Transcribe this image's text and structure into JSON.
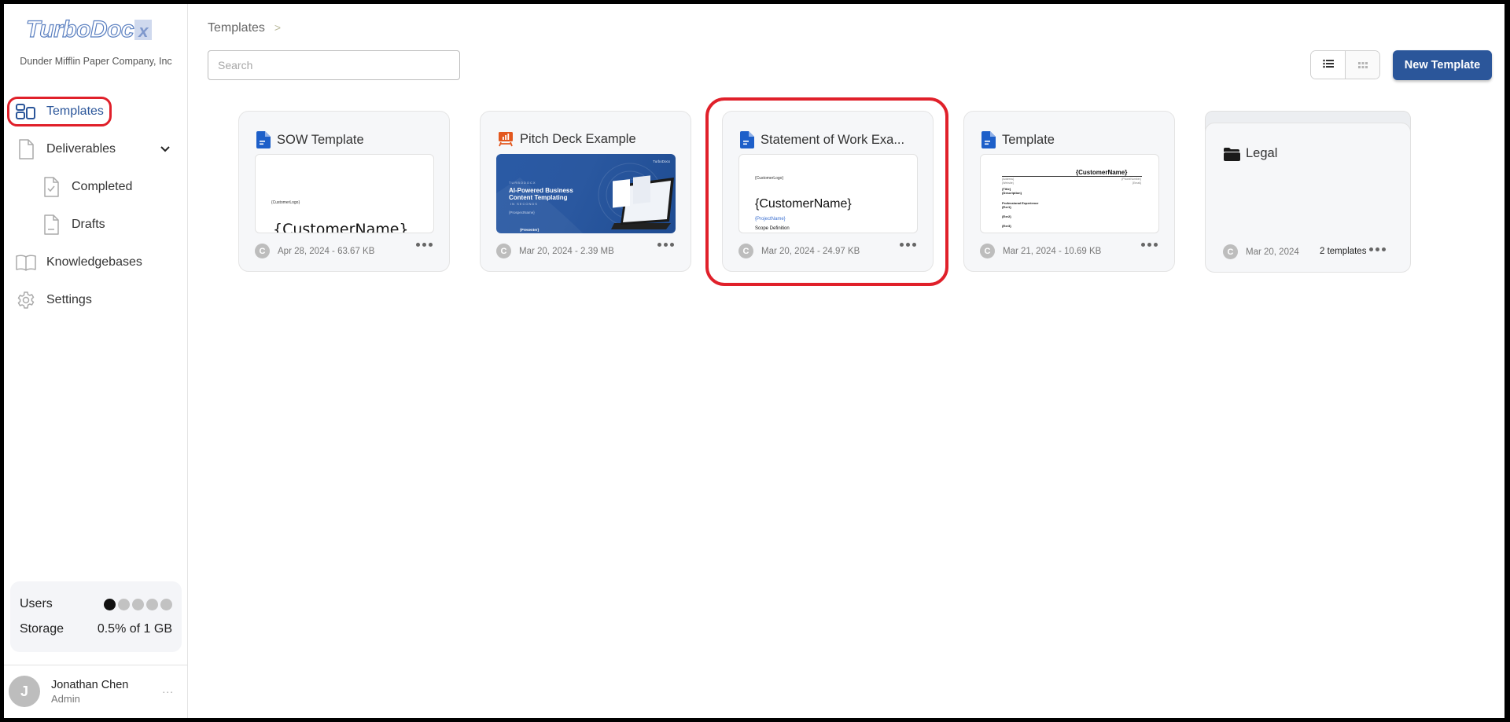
{
  "app": {
    "brand": "TurboDoc",
    "brand_suffix": "x",
    "organization": "Dunder Mifflin Paper Company, Inc"
  },
  "sidebar": {
    "items": [
      {
        "label": "Templates",
        "icon": "templates-grid-icon",
        "active": true
      },
      {
        "label": "Deliverables",
        "icon": "document-icon",
        "expanded": true
      },
      {
        "label": "Completed",
        "icon": "document-check-icon",
        "sub": true
      },
      {
        "label": "Drafts",
        "icon": "document-lines-icon",
        "sub": true
      },
      {
        "label": "Knowledgebases",
        "icon": "book-icon"
      },
      {
        "label": "Settings",
        "icon": "gear-icon"
      }
    ],
    "stats": {
      "users_label": "Users",
      "users_used": 1,
      "users_total": 5,
      "storage_label": "Storage",
      "storage_value": "0.5% of 1 GB"
    },
    "user": {
      "initial": "J",
      "name": "Jonathan Chen",
      "role": "Admin",
      "more": "..."
    }
  },
  "header": {
    "breadcrumb": "Templates",
    "breadcrumb_sep": ">",
    "search_placeholder": "Search",
    "search_value": "",
    "view_modes": [
      "list",
      "grid"
    ],
    "active_view": "list",
    "new_button": "New Template"
  },
  "colors": {
    "accent": "#2b569a",
    "highlight": "#e0202a",
    "doc_icon": "#1d5fc9",
    "slides_icon": "#e3581f"
  },
  "templates": [
    {
      "name": "SOW Template",
      "type": "document",
      "owner_initial": "C",
      "meta": "Apr 28, 2024 - 63.67 KB",
      "preview": {
        "logo": "{CustomerLogo}",
        "heading": "{CustomerName}"
      }
    },
    {
      "name": "Pitch Deck Example",
      "type": "presentation",
      "owner_initial": "C",
      "meta": "Mar 20, 2024 - 2.39 MB",
      "preview": {
        "brand_small": "TurboDocx",
        "kicker": "TURBODOCX",
        "headline1": "AI-Powered Business",
        "headline2": "Content Templating",
        "sub": "IN SECONDS",
        "prospect": "{ProspectName}",
        "presenter": "{Presenter}"
      }
    },
    {
      "name": "Statement of Work Exa...",
      "type": "document",
      "owner_initial": "C",
      "meta": "Mar 20, 2024 - 24.97 KB",
      "highlighted": true,
      "preview": {
        "logo": "{CustomerLogo}",
        "heading": "{CustomerName}",
        "project": "{ProjectName}",
        "section": "Scope Definition"
      }
    },
    {
      "name": "Template",
      "type": "document",
      "owner_initial": "C",
      "meta": "Mar 21, 2024 - 10.69 KB",
      "preview": {
        "heading": "{CustomerName}",
        "address": "{Address}",
        "website": "{Website}",
        "phone": "{PhoneNumber}",
        "email": "{Email}",
        "title": "{Title}",
        "description": "{Description}",
        "section": "Professional Experience",
        "exp1": "{Exr1}",
        "exp2": "{Exr2}",
        "exp3": "{Exr3}"
      }
    }
  ],
  "folders": [
    {
      "name": "Legal",
      "owner_initial": "C",
      "date": "Mar 20, 2024",
      "count": "2 templates"
    }
  ]
}
